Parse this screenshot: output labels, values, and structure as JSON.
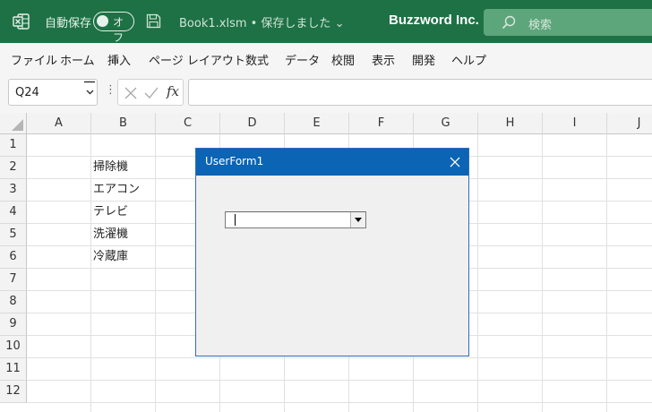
{
  "titlebar": {
    "autosave_label": "自動保存",
    "autosave_state": "オフ",
    "document_name": "Book1.xlsm • 保存しました ⌄",
    "company": "Buzzword Inc.",
    "search_placeholder": "検索",
    "accent": "#1e7145"
  },
  "menu": {
    "items": [
      "ファイル",
      "ホーム",
      "挿入",
      "ページ レイアウト",
      "数式",
      "データ",
      "校閲",
      "表示",
      "開発",
      "ヘルプ"
    ]
  },
  "formula_bar": {
    "name_box": "Q24",
    "dots": "⋮",
    "fx": "fx",
    "formula": ""
  },
  "sheet": {
    "columns": [
      "A",
      "B",
      "C",
      "D",
      "E",
      "F",
      "G",
      "H",
      "I",
      "J"
    ],
    "rows": [
      "1",
      "2",
      "3",
      "4",
      "5",
      "6",
      "7",
      "8",
      "9",
      "10",
      "11",
      "12"
    ],
    "cells_B": [
      "掃除機",
      "エアコン",
      "テレビ",
      "洗濯機",
      "冷蔵庫"
    ]
  },
  "userform": {
    "title": "UserForm1",
    "combo_value": "",
    "title_color": "#0b64b4"
  }
}
